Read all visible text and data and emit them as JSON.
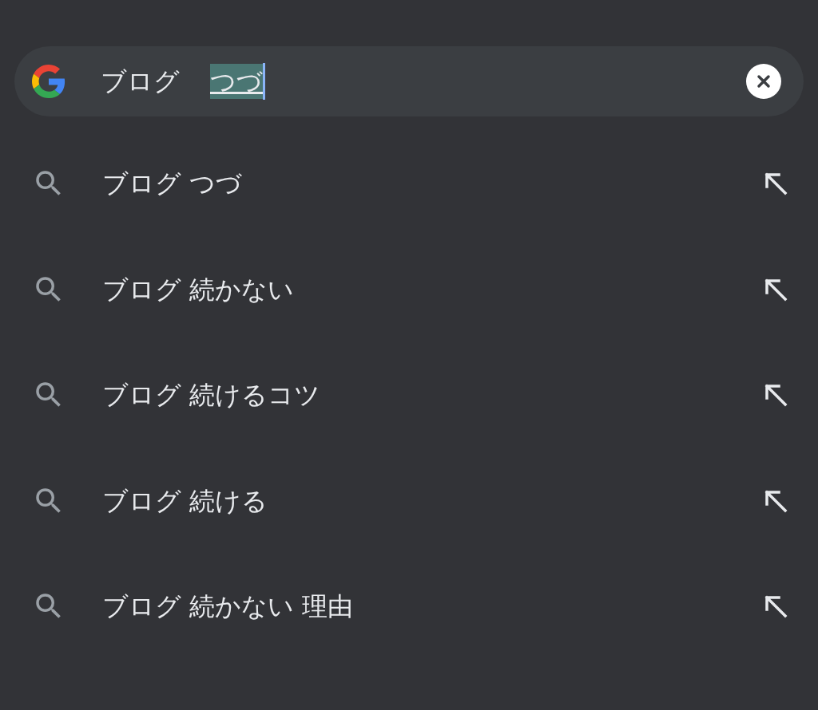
{
  "search": {
    "query": "ブログ",
    "composing": "つづ"
  },
  "suggestions": [
    {
      "text": "ブログ つづ"
    },
    {
      "text": "ブログ 続かない"
    },
    {
      "text": "ブログ 続けるコツ"
    },
    {
      "text": "ブログ 続ける"
    },
    {
      "text": "ブログ 続かない 理由"
    }
  ]
}
